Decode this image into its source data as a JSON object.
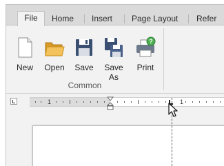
{
  "tabs": [
    {
      "label": "File",
      "active": true
    },
    {
      "label": "Home",
      "active": false
    },
    {
      "label": "Insert",
      "active": false
    },
    {
      "label": "Page Layout",
      "active": false
    },
    {
      "label": "Refer",
      "active": false
    }
  ],
  "ribbon": {
    "buttons": [
      {
        "label": "New",
        "icon": "new-document-icon"
      },
      {
        "label": "Open",
        "icon": "open-folder-icon"
      },
      {
        "label": "Save",
        "icon": "save-disk-icon"
      },
      {
        "label": "Save\nAs",
        "icon": "save-as-icon"
      },
      {
        "label": "Print",
        "icon": "print-icon"
      }
    ],
    "group_label": "Common"
  },
  "ruler": {
    "left_number": "1",
    "right_number": "1"
  },
  "colors": {
    "tabstrip": "#dadada",
    "ribbon": "#f2f2f2",
    "ruler_margin": "#dcdcdc",
    "folder": "#f0b23c",
    "disk": "#3b4f70",
    "help_badge": "#4caf50"
  }
}
